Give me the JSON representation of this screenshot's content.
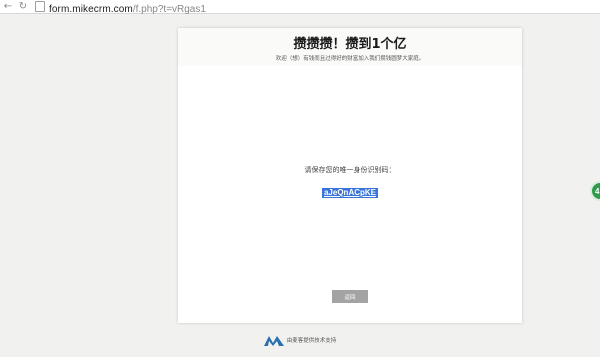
{
  "browser": {
    "url_host": "form.mikecrm.com",
    "url_path": "/f.php?t=vRgas1"
  },
  "form": {
    "title": "攒攒攒！攒到1个亿",
    "subtitle": "欢迎（想）有钱而且过得好的财富加入我们攒钱圆梦大家庭。",
    "prompt": "请保存您的唯一身份识别码：",
    "code": "aJeQnACpKE",
    "return_label": "返回"
  },
  "footer": {
    "text": "由麦客提供技术支持"
  },
  "side_badge": {
    "label": "4"
  },
  "colors": {
    "background": "#f1f1ef",
    "code_highlight": "#3a74d8",
    "button": "#a3a3a3",
    "badge": "#2e9a4a",
    "logo": "#2a6fb0"
  }
}
